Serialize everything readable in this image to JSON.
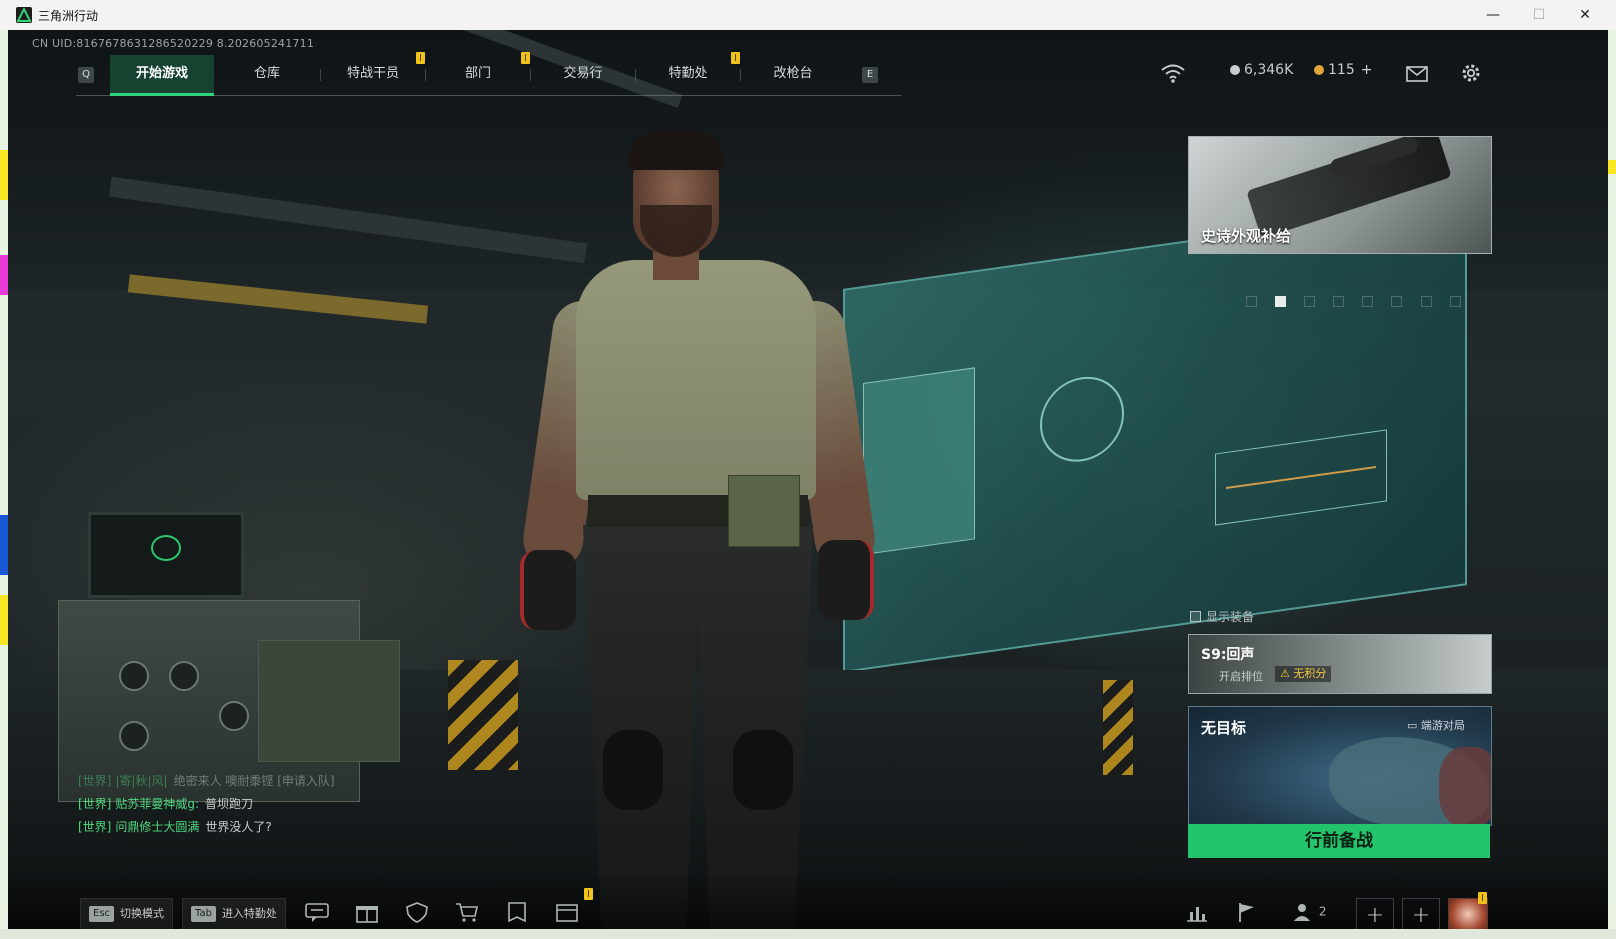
{
  "window": {
    "title": "三角洲行动",
    "minimize": "—",
    "maximize": "☐",
    "close": "✕"
  },
  "uid_text": "CN UID:8167678631286520229 8.202605241711",
  "nav": {
    "left_key": "Q",
    "right_key": "E",
    "tabs": [
      {
        "label": "开始游戏",
        "active": true,
        "alert": false
      },
      {
        "label": "仓库",
        "active": false,
        "alert": false
      },
      {
        "label": "特战干员",
        "active": false,
        "alert": true
      },
      {
        "label": "部门",
        "active": false,
        "alert": true
      },
      {
        "label": "交易行",
        "active": false,
        "alert": false
      },
      {
        "label": "特勤处",
        "active": false,
        "alert": true
      },
      {
        "label": "改枪台",
        "active": false,
        "alert": false
      }
    ]
  },
  "currency": {
    "silver": "6,346K",
    "gold": "115",
    "add": "+",
    "silver_color": "#c8cdd0",
    "gold_color": "#e2a53a"
  },
  "icons": {
    "wifi": "wifi-icon",
    "mail": "mail-icon",
    "settings": "gear-icon"
  },
  "promo": {
    "title": "史诗外观补给",
    "page_count": 8,
    "active_page": 1
  },
  "show_gear": "显示装备",
  "season": {
    "title": "S9:回声",
    "subtitle": "开启排位",
    "badge": "无积分"
  },
  "map_card": {
    "title": "无目标",
    "tag": "端游对局"
  },
  "ready_button": "行前备战",
  "chat": [
    {
      "channel": "[世界]",
      "user": "|寄|秋|风|",
      "text": "绝密来人 噢耐黍铿 [申请入队]",
      "faded": true
    },
    {
      "channel": "[世界]",
      "user": "贴苏菲曼神威g:",
      "text": "普坝跑刀",
      "faded": false
    },
    {
      "channel": "[世界]",
      "user": "问鼎修士大圆满",
      "text": "世界没人了?",
      "faded": false
    }
  ],
  "bottom_bar": {
    "esc_key": "Esc",
    "esc_label": "切换模式",
    "tab_key": "Tab",
    "tab_label": "进入特勤处",
    "squad_count": "2",
    "slot_plus": "+"
  },
  "colors": {
    "accent_green": "#23c46b",
    "nav_active": "#2ed37a",
    "alert_yellow": "#f1c21b",
    "chat_channel": "#4fd97e"
  }
}
